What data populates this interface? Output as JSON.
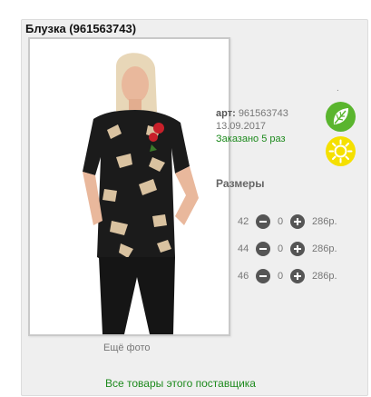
{
  "product": {
    "title": "Блузка (961563743)",
    "more_photos": "Ещё фото",
    "supplier_link": "Все товары этого поставщика",
    "dot": "."
  },
  "info": {
    "art_label": "арт:",
    "art_value": "961563743",
    "date": "13.09.2017",
    "ordered": "Заказано 5 раз"
  },
  "badges": {
    "leaf_icon": "leaf-icon",
    "sun_icon": "sun-icon",
    "leaf_color": "#5ab52e",
    "sun_color": "#f5e000"
  },
  "sizes": {
    "title": "Размеры",
    "rows": [
      {
        "size": "42",
        "qty": "0",
        "price": "286р."
      },
      {
        "size": "44",
        "qty": "0",
        "price": "286р."
      },
      {
        "size": "46",
        "qty": "0",
        "price": "286р."
      }
    ]
  },
  "colors": {
    "accent_green": "#1d8a1d",
    "card_bg": "#efefef"
  }
}
